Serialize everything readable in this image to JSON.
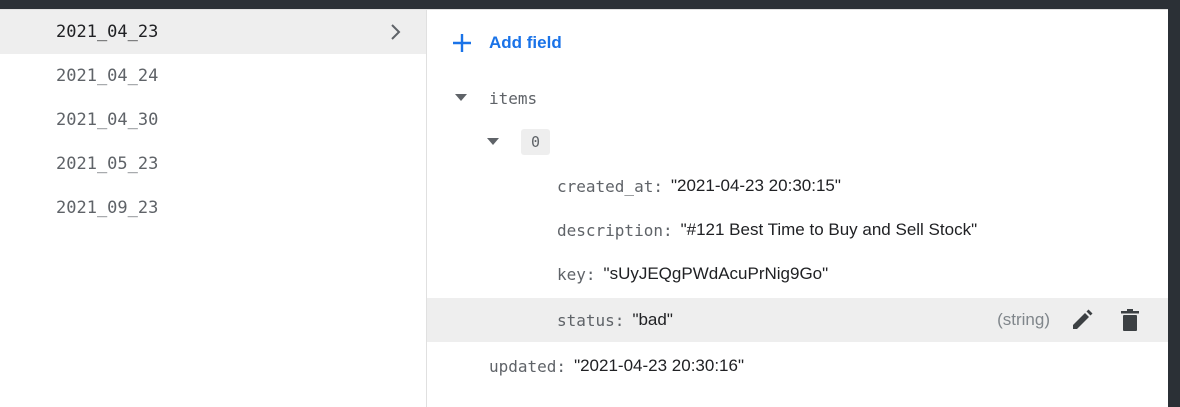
{
  "documents": [
    {
      "name": "2021_04_23",
      "selected": true
    },
    {
      "name": "2021_04_24",
      "selected": false
    },
    {
      "name": "2021_04_30",
      "selected": false
    },
    {
      "name": "2021_05_23",
      "selected": false
    },
    {
      "name": "2021_09_23",
      "selected": false
    }
  ],
  "add_field_label": "Add field",
  "fields": {
    "items_key": "items",
    "index_key": "0",
    "created_at": {
      "key": "created_at:",
      "value": "\"2021-04-23 20:30:15\""
    },
    "description": {
      "key": "description:",
      "value": "\"#121 Best Time to Buy and Sell Stock\""
    },
    "key": {
      "key": "key:",
      "value": "\"sUyJEQgPWdAcuPrNig9Go\""
    },
    "status": {
      "key": "status:",
      "value": "\"bad\"",
      "type_hint": "(string)"
    },
    "updated": {
      "key": "updated:",
      "value": "\"2021-04-23 20:30:16\""
    }
  },
  "colors": {
    "accent": "#1a73e8",
    "selected_bg": "#eeeeee",
    "frame_bg": "#2b3036"
  },
  "icons": [
    "chevron-right-icon",
    "plus-icon",
    "caret-down-icon",
    "pencil-icon",
    "trash-icon"
  ]
}
